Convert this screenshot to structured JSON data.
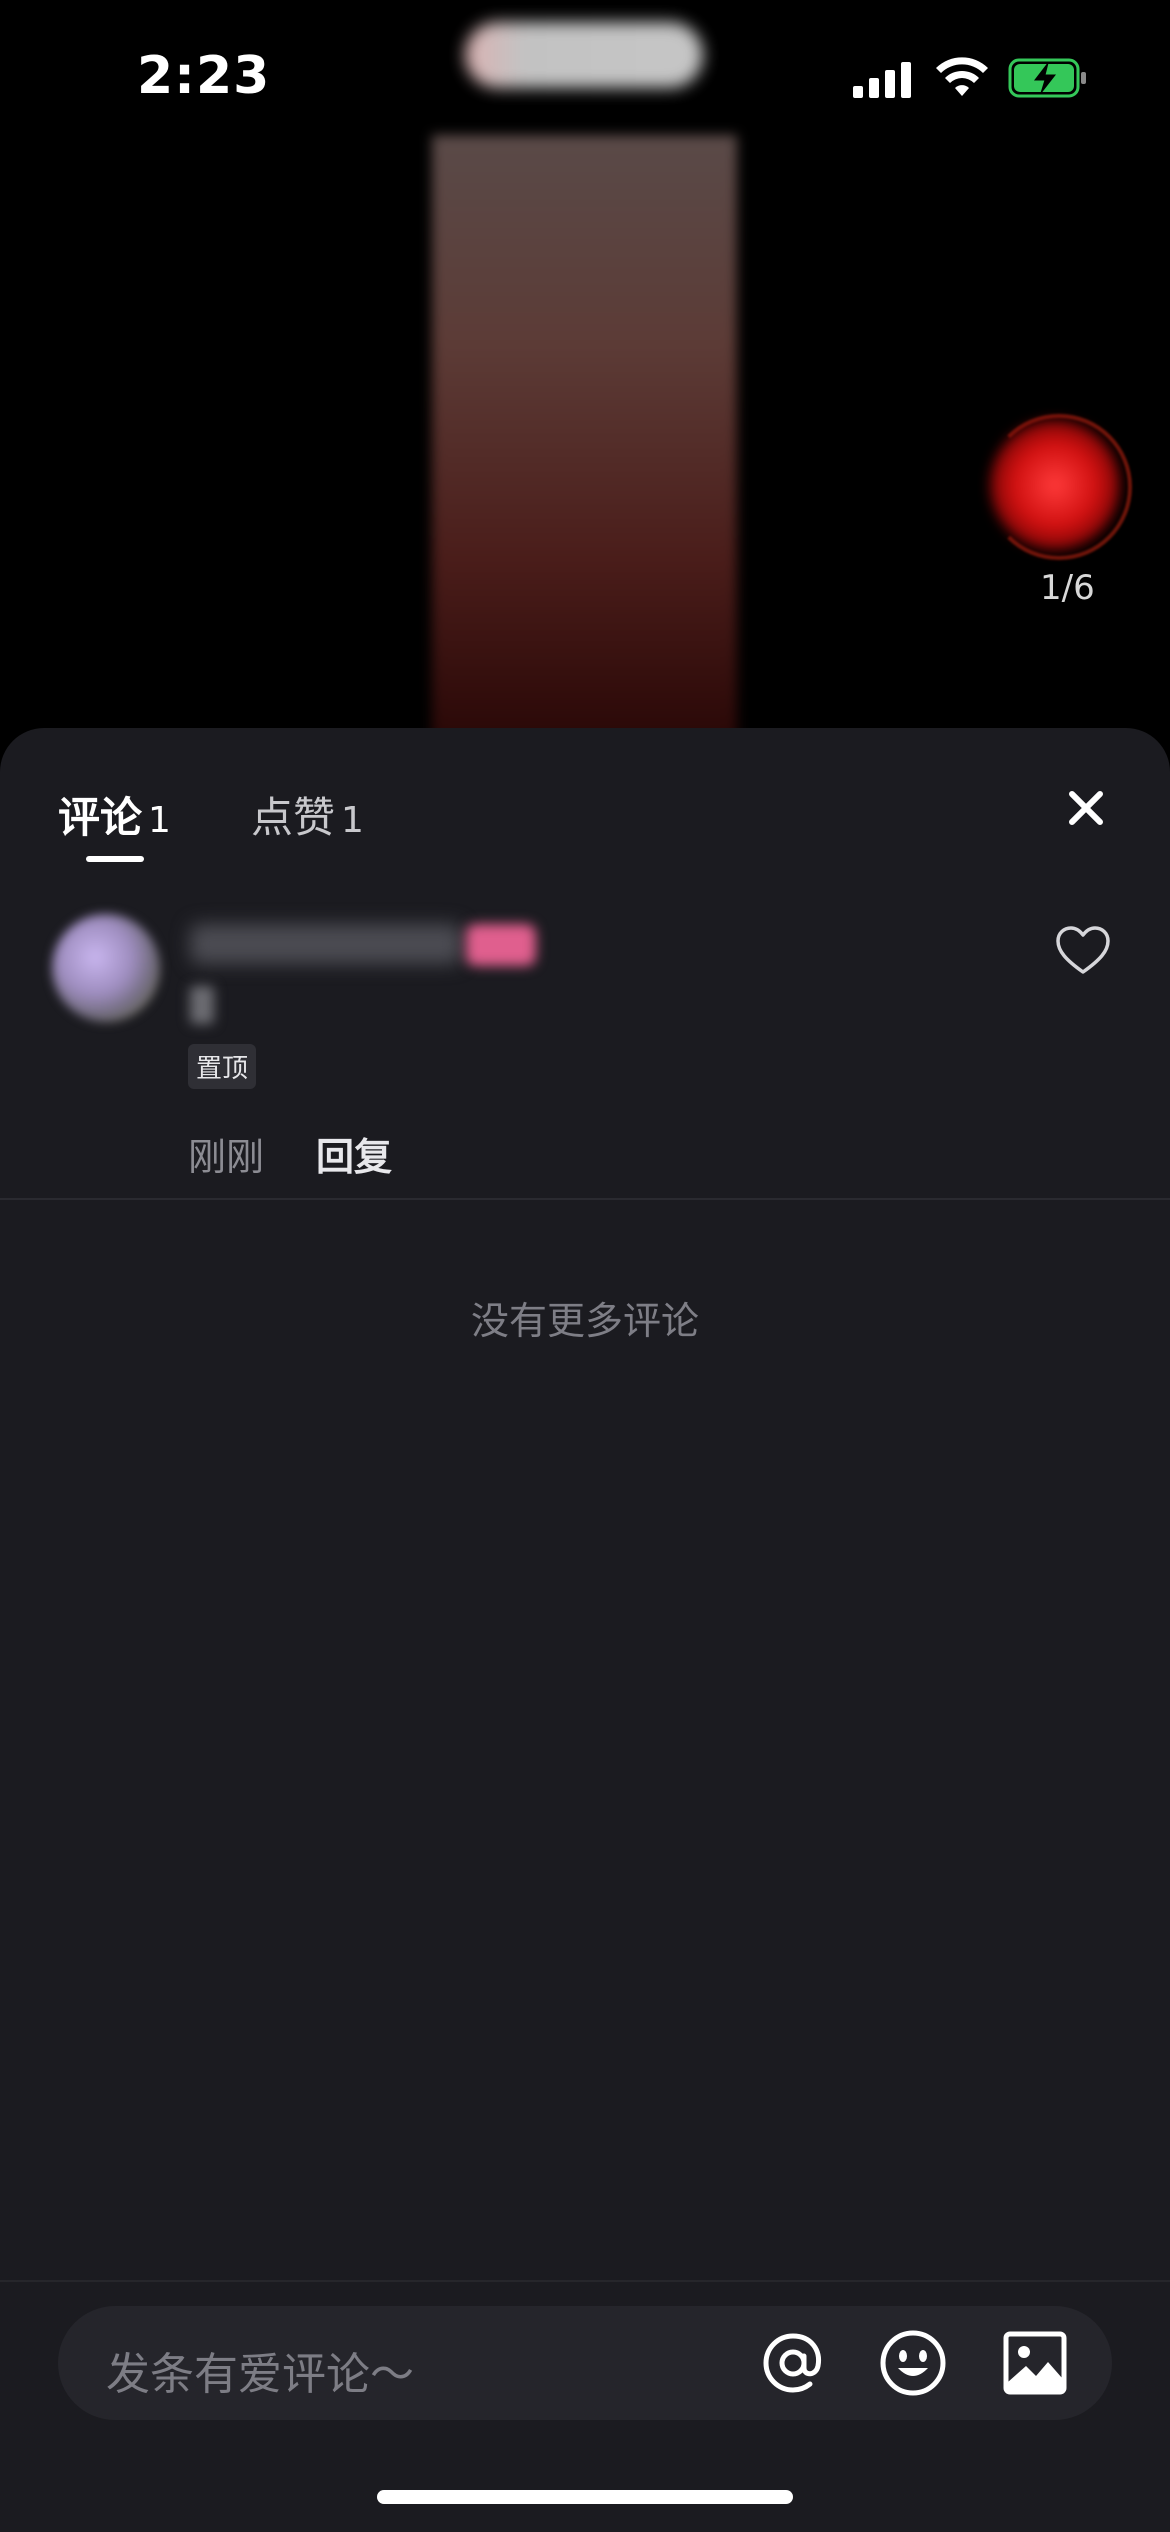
{
  "status_bar": {
    "time": "2:23"
  },
  "video": {
    "page_indicator": "1/6"
  },
  "tabs": [
    {
      "label": "评论",
      "count": "1"
    },
    {
      "label": "点赞",
      "count": "1"
    }
  ],
  "comment": {
    "pinned_label": "置顶",
    "time": "刚刚",
    "reply_label": "回复"
  },
  "list_end_text": "没有更多评论",
  "composer": {
    "placeholder": "发条有爱评论～"
  },
  "icons": [
    "close-icon",
    "heart-icon",
    "at-icon",
    "emoji-icon",
    "image-icon"
  ],
  "colors": {
    "sheet_bg": "#1b1b20",
    "input_bg": "#25252b",
    "battery_green": "#34c759"
  }
}
